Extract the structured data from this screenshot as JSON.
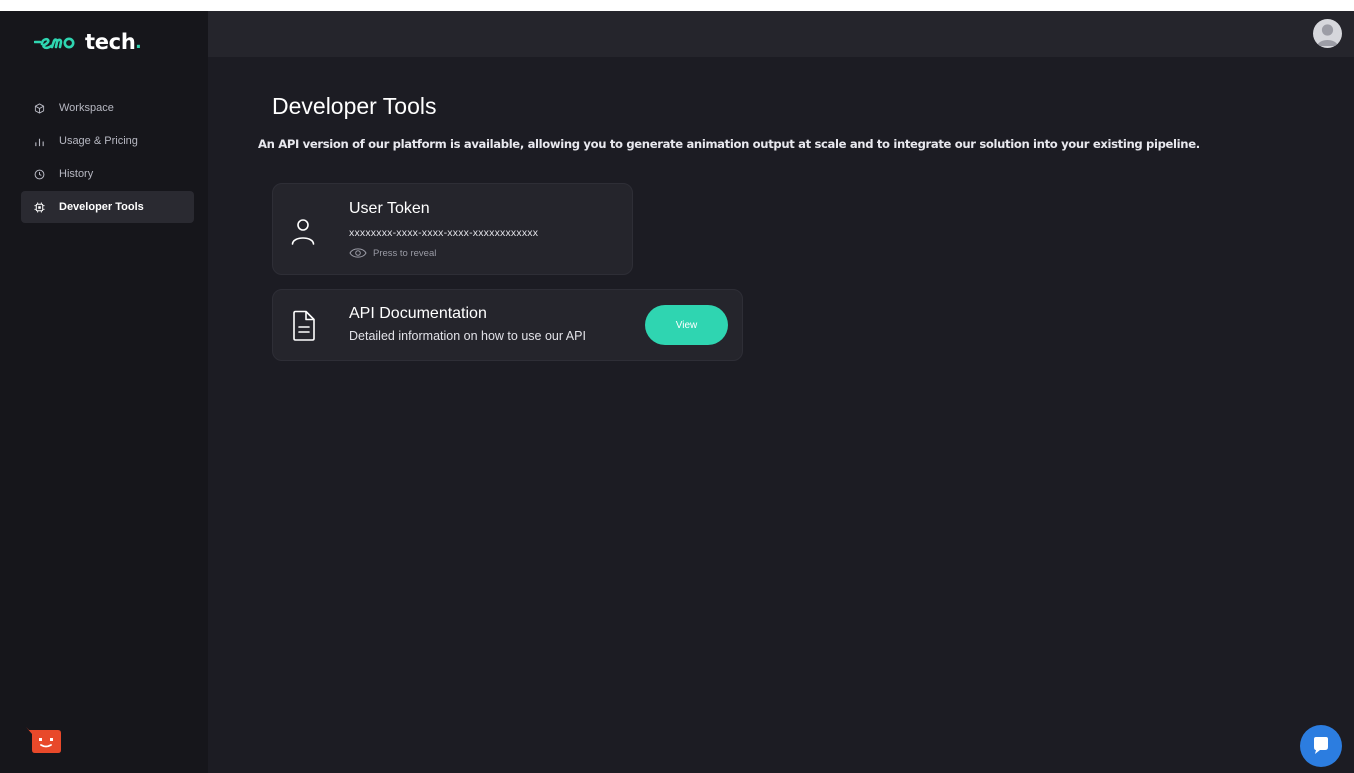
{
  "app": {
    "logo_text": "tech",
    "logo_dot": "."
  },
  "sidebar": {
    "items": [
      {
        "label": "Workspace",
        "icon": "cube-icon",
        "active": false
      },
      {
        "label": "Usage & Pricing",
        "icon": "bar-chart-icon",
        "active": false
      },
      {
        "label": "History",
        "icon": "clock-icon",
        "active": false
      },
      {
        "label": "Developer Tools",
        "icon": "cpu-icon",
        "active": true
      }
    ]
  },
  "header": {
    "avatar_icon": "user-avatar-icon"
  },
  "main": {
    "title": "Developer Tools",
    "description": "An API version of our platform is available, allowing you to generate animation output at scale and to integrate our solution into your existing pipeline."
  },
  "token_card": {
    "title": "User Token",
    "value": "xxxxxxxx-xxxx-xxxx-xxxx-xxxxxxxxxxxx",
    "reveal_label": "Press to reveal",
    "icon": "user-icon"
  },
  "docs_card": {
    "title": "API Documentation",
    "subtitle": "Detailed information on how to use our API",
    "button_label": "View",
    "icon": "document-icon"
  },
  "colors": {
    "accent": "#2fd5b1",
    "background": "#1c1c23",
    "sidebar": "#16161b",
    "card": "#25252c",
    "chat": "#2c7de0",
    "badge": "#e8492a"
  }
}
